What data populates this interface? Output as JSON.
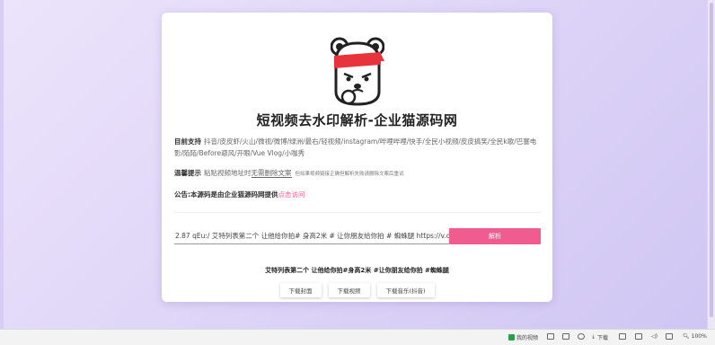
{
  "page": {
    "title": "短视频去水印解析-企业猫源码网",
    "support_label": "目前支持",
    "support_text": "抖音/皮皮虾/火山/微视/微博/绿洲/最右/轻视频/instagram/哔哩哔哩/快手/全民小视频/皮皮搞笑/全民k歌/巴塞电影/陌陌/Before避风/开眼/Vue Vlog/小咖秀",
    "tip_label": "温馨提示",
    "tip_text_1": "粘贴视频地址时",
    "tip_text_underlined": "无需删除文案",
    "tip_small": "但如果视频链接正确但解析失败请删除文案后重试",
    "notice_text": "公告:本源码是由企业猫源码网提供",
    "notice_link": "点击访问",
    "input_value": "2.87 qEu:/ 艾特列表第二个 让他给你拍# 身高2米 # 让你朋友给你拍 # 蜘蛛腿 https://v.douyin.com/",
    "parse_label": "解析",
    "result_title": "艾特列表第二个 让他给你拍#身高2米 #让你朋友给你拍 #蜘蛛腿",
    "buttons": {
      "cover": "下载封面",
      "video": "下载视频",
      "music": "下载音乐(抖音)"
    }
  },
  "statusbar": {
    "my_video": "我的视频",
    "download": "下载",
    "zoom": "100%"
  },
  "colors": {
    "accent": "#f15c8f",
    "link": "#f05c8c",
    "background_start": "#ece4fb",
    "background_end": "#cfc6f3"
  }
}
